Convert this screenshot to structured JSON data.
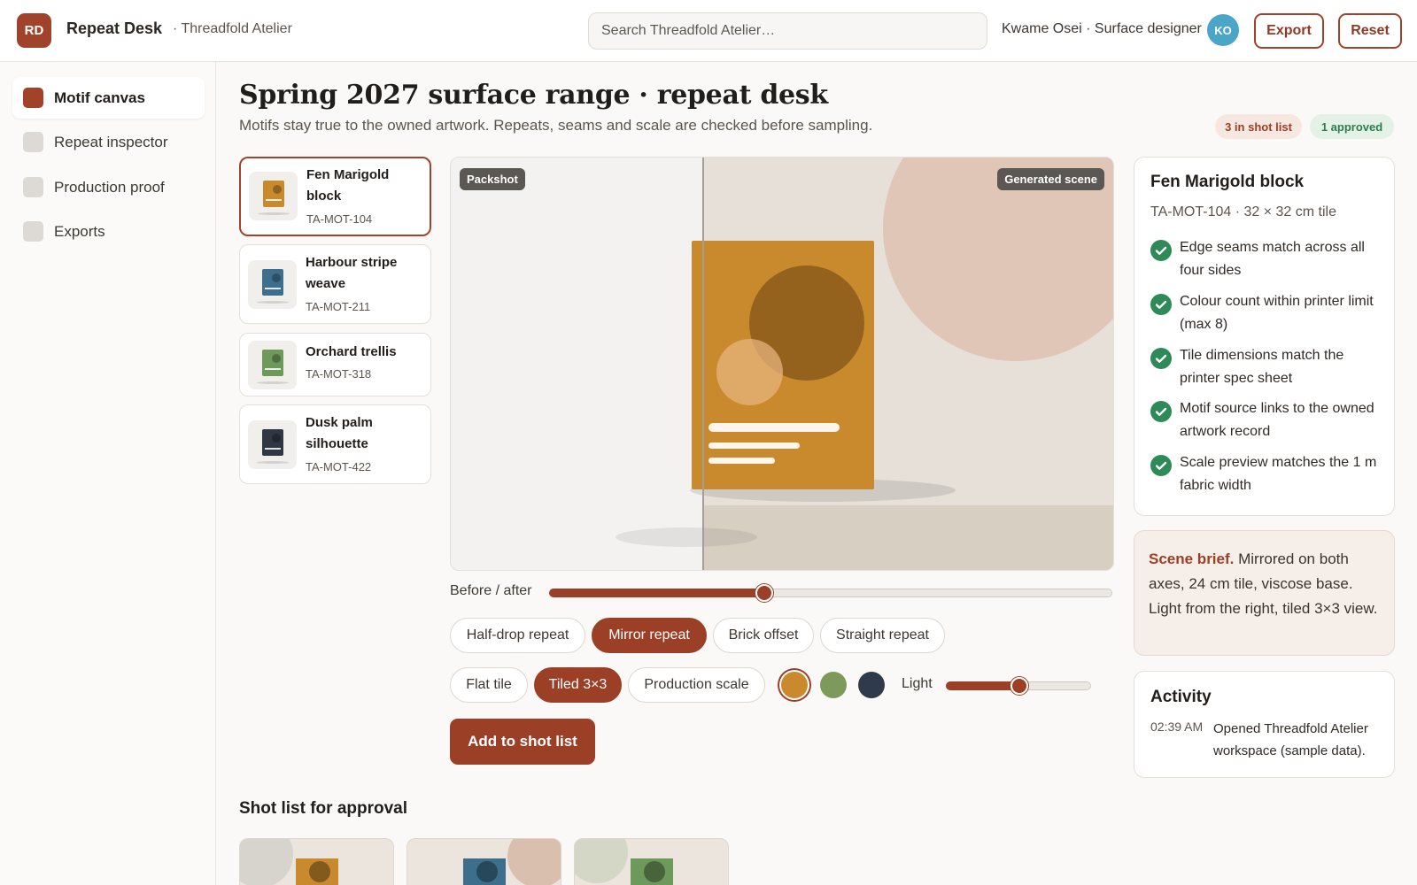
{
  "header": {
    "logo": "RD",
    "app_name": "Repeat Desk",
    "workspace": "· Threadfold Atelier",
    "search_placeholder": "Search Threadfold Atelier…",
    "user": "Kwame Osei · Surface designer",
    "avatar": "KO",
    "export_label": "Export",
    "reset_label": "Reset"
  },
  "sidebar": {
    "items": [
      {
        "label": "Motif canvas",
        "active": true
      },
      {
        "label": "Repeat inspector",
        "active": false
      },
      {
        "label": "Production proof",
        "active": false
      },
      {
        "label": "Exports",
        "active": false
      }
    ]
  },
  "page": {
    "title": "Spring 2027 surface range · repeat desk",
    "subtitle": "Motifs stay true to the owned artwork. Repeats, seams and scale are checked before sampling.",
    "badges": {
      "shot_list": "3 in shot list",
      "approved": "1 approved"
    }
  },
  "motifs": [
    {
      "name": "Fen Marigold block",
      "code": "TA-MOT-104",
      "color": "#c98a2e",
      "selected": true
    },
    {
      "name": "Harbour stripe weave",
      "code": "TA-MOT-211",
      "color": "#3d6e8c",
      "selected": false
    },
    {
      "name": "Orchard trellis",
      "code": "TA-MOT-318",
      "color": "#6d9a5a",
      "selected": false
    },
    {
      "name": "Dusk palm silhouette",
      "code": "TA-MOT-422",
      "color": "#2f3644",
      "selected": false
    }
  ],
  "canvas": {
    "left_tag": "Packshot",
    "right_tag": "Generated scene",
    "before_after_label": "Before / after",
    "before_after_value": 0.38
  },
  "repeat_modes": [
    {
      "label": "Half-drop repeat",
      "on": false
    },
    {
      "label": "Mirror repeat",
      "on": true
    },
    {
      "label": "Brick offset",
      "on": false
    },
    {
      "label": "Straight repeat",
      "on": false
    }
  ],
  "views": [
    {
      "label": "Flat tile",
      "on": false
    },
    {
      "label": "Tiled 3×3",
      "on": true
    },
    {
      "label": "Production scale",
      "on": false
    }
  ],
  "swatches": [
    {
      "color": "#c98a2e",
      "selected": true
    },
    {
      "color": "#7e9a5a",
      "selected": false
    },
    {
      "color": "#2f3a4a",
      "selected": false
    }
  ],
  "light": {
    "label": "Light",
    "value": 0.5
  },
  "add_button": "Add to shot list",
  "shot_list": {
    "title": "Shot list for approval"
  },
  "detail": {
    "title": "Fen Marigold block",
    "meta": "TA-MOT-104 · 32 × 32 cm tile",
    "checks": [
      "Edge seams match across all four sides",
      "Colour count within printer limit (max 8)",
      "Tile dimensions match the printer spec sheet",
      "Motif source links to the owned artwork record",
      "Scale preview matches the 1 m fabric width"
    ]
  },
  "brief": {
    "label": "Scene brief.",
    "text": " Mirrored on both axes, 24 cm tile, viscose base. Light from the right, tiled 3×3 view."
  },
  "activity": {
    "title": "Activity",
    "time": "02:39 AM",
    "text": "Opened Threadfold Atelier workspace (sample data)."
  },
  "colors": {
    "accent": "#9b3f27",
    "success": "#2e8b57"
  }
}
